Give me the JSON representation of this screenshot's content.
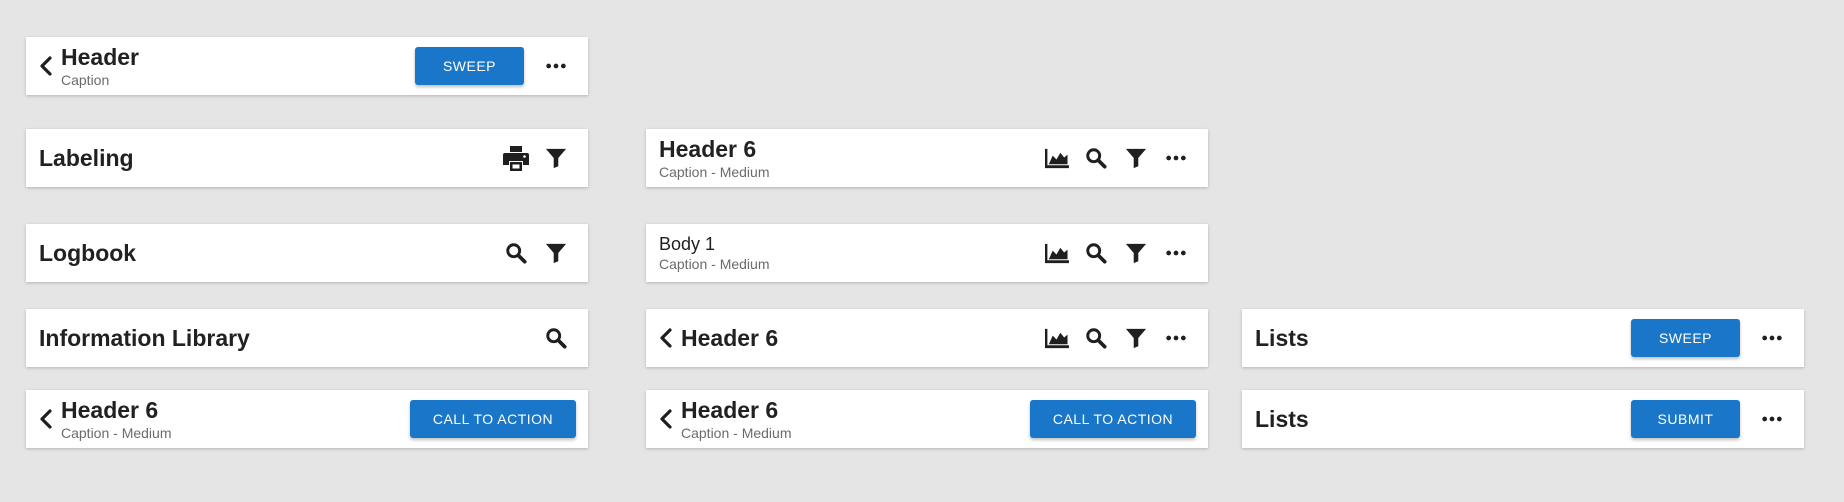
{
  "bars": {
    "b1": {
      "title": "Header",
      "caption": "Caption",
      "button": "SWEEP"
    },
    "b2": {
      "title": "Labeling"
    },
    "b3": {
      "title": "Logbook"
    },
    "b4": {
      "title": "Information Library"
    },
    "b5": {
      "title": "Header 6",
      "caption": "Caption - Medium",
      "button": "CALL TO ACTION"
    },
    "b6": {
      "title": "Header 6",
      "caption": "Caption - Medium"
    },
    "b7": {
      "title": "Body 1",
      "caption": "Caption - Medium"
    },
    "b8": {
      "title": "Header 6"
    },
    "b9": {
      "title": "Header 6",
      "caption": "Caption - Medium",
      "button": "CALL TO ACTION"
    },
    "b10": {
      "title": "Lists",
      "button": "SWEEP"
    },
    "b11": {
      "title": "Lists",
      "button": "SUBMIT"
    }
  },
  "icons": [
    "chevron-left-icon",
    "more-horizontal-icon",
    "printer-icon",
    "filter-icon",
    "search-icon",
    "area-chart-icon"
  ],
  "colors": {
    "background": "#e5e5e5",
    "surface": "#ffffff",
    "primary": "#1976c8",
    "text": "#212121",
    "caption": "#6b6b6b"
  }
}
